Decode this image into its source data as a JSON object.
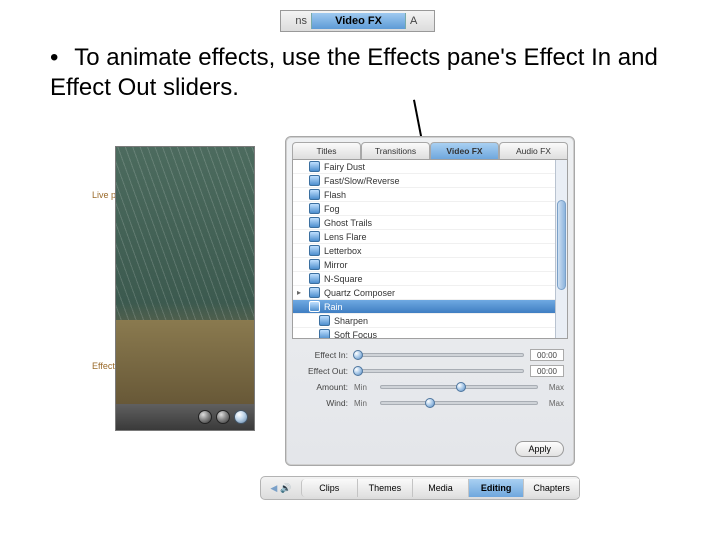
{
  "top_crop": {
    "left_frag": "ns",
    "active": "Video FX",
    "right_frag": "A"
  },
  "bullet": {
    "text": "To animate effects, use the Effects pane's Effect In and Effect Out sliders."
  },
  "callouts": {
    "live_preview": "Live preview",
    "effect_sliders": "Effect-specific sliders"
  },
  "panel": {
    "tabs": [
      "Titles",
      "Transitions",
      "Video FX",
      "Audio FX"
    ],
    "active_tab_index": 2,
    "effects": [
      "Fairy Dust",
      "Fast/Slow/Reverse",
      "Flash",
      "Fog",
      "Ghost Trails",
      "Lens Flare",
      "Letterbox",
      "Mirror",
      "N-Square",
      "Quartz Composer",
      "Rain",
      "Sharpen",
      "Soft Focus"
    ],
    "selected_index": 10,
    "expandable_index": 9,
    "sliders": {
      "effect_in": {
        "label": "Effect In:",
        "value": "00:00"
      },
      "effect_out": {
        "label": "Effect Out:",
        "value": "00:00"
      },
      "amount": {
        "label": "Amount:",
        "min": "Min",
        "max": "Max"
      },
      "wind": {
        "label": "Wind:",
        "min": "Min",
        "max": "Max"
      }
    },
    "apply": "Apply"
  },
  "bottom_tabs": {
    "items": [
      "Clips",
      "Themes",
      "Media",
      "Editing",
      "Chapters"
    ],
    "active_index": 3
  }
}
